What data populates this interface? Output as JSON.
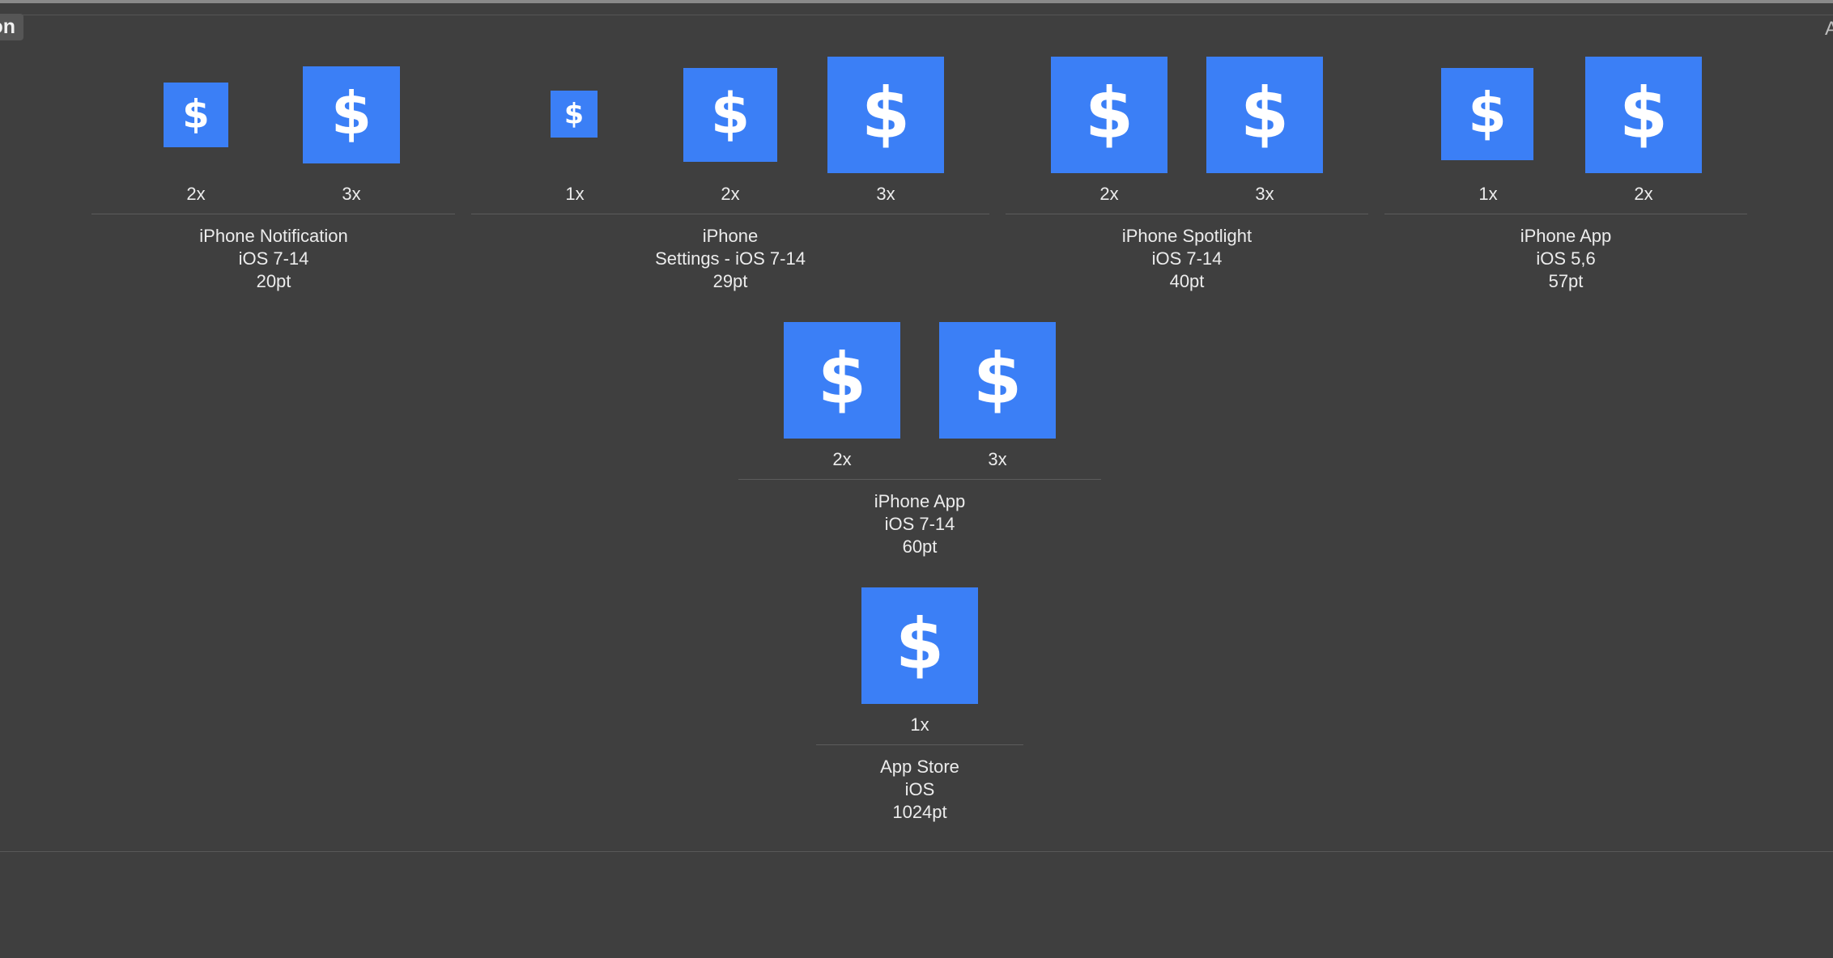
{
  "window": {
    "tab_fragment": "on",
    "corner_glyph": "A"
  },
  "icon": {
    "symbol": "$",
    "background": "#3b7ff6",
    "glyph_color": "#ffffff"
  },
  "groups": [
    {
      "id": "iphone-notification",
      "title_lines": [
        "iPhone Notification",
        "iOS 7-14",
        "20pt"
      ],
      "slots": [
        {
          "scale": "2x"
        },
        {
          "scale": "3x"
        }
      ]
    },
    {
      "id": "iphone-settings",
      "title_lines": [
        "iPhone",
        "Settings - iOS 7-14",
        "29pt"
      ],
      "slots": [
        {
          "scale": "1x"
        },
        {
          "scale": "2x"
        },
        {
          "scale": "3x"
        }
      ]
    },
    {
      "id": "iphone-spotlight",
      "title_lines": [
        "iPhone Spotlight",
        "iOS 7-14",
        "40pt"
      ],
      "slots": [
        {
          "scale": "2x"
        },
        {
          "scale": "3x"
        }
      ]
    },
    {
      "id": "iphone-app-57",
      "title_lines": [
        "iPhone App",
        "iOS 5,6",
        "57pt"
      ],
      "slots": [
        {
          "scale": "1x"
        },
        {
          "scale": "2x"
        }
      ]
    },
    {
      "id": "iphone-app-60",
      "title_lines": [
        "iPhone App",
        "iOS 7-14",
        "60pt"
      ],
      "slots": [
        {
          "scale": "2x"
        },
        {
          "scale": "3x"
        }
      ]
    },
    {
      "id": "app-store",
      "title_lines": [
        "App Store",
        "iOS",
        "1024pt"
      ],
      "slots": [
        {
          "scale": "1x"
        }
      ]
    }
  ]
}
